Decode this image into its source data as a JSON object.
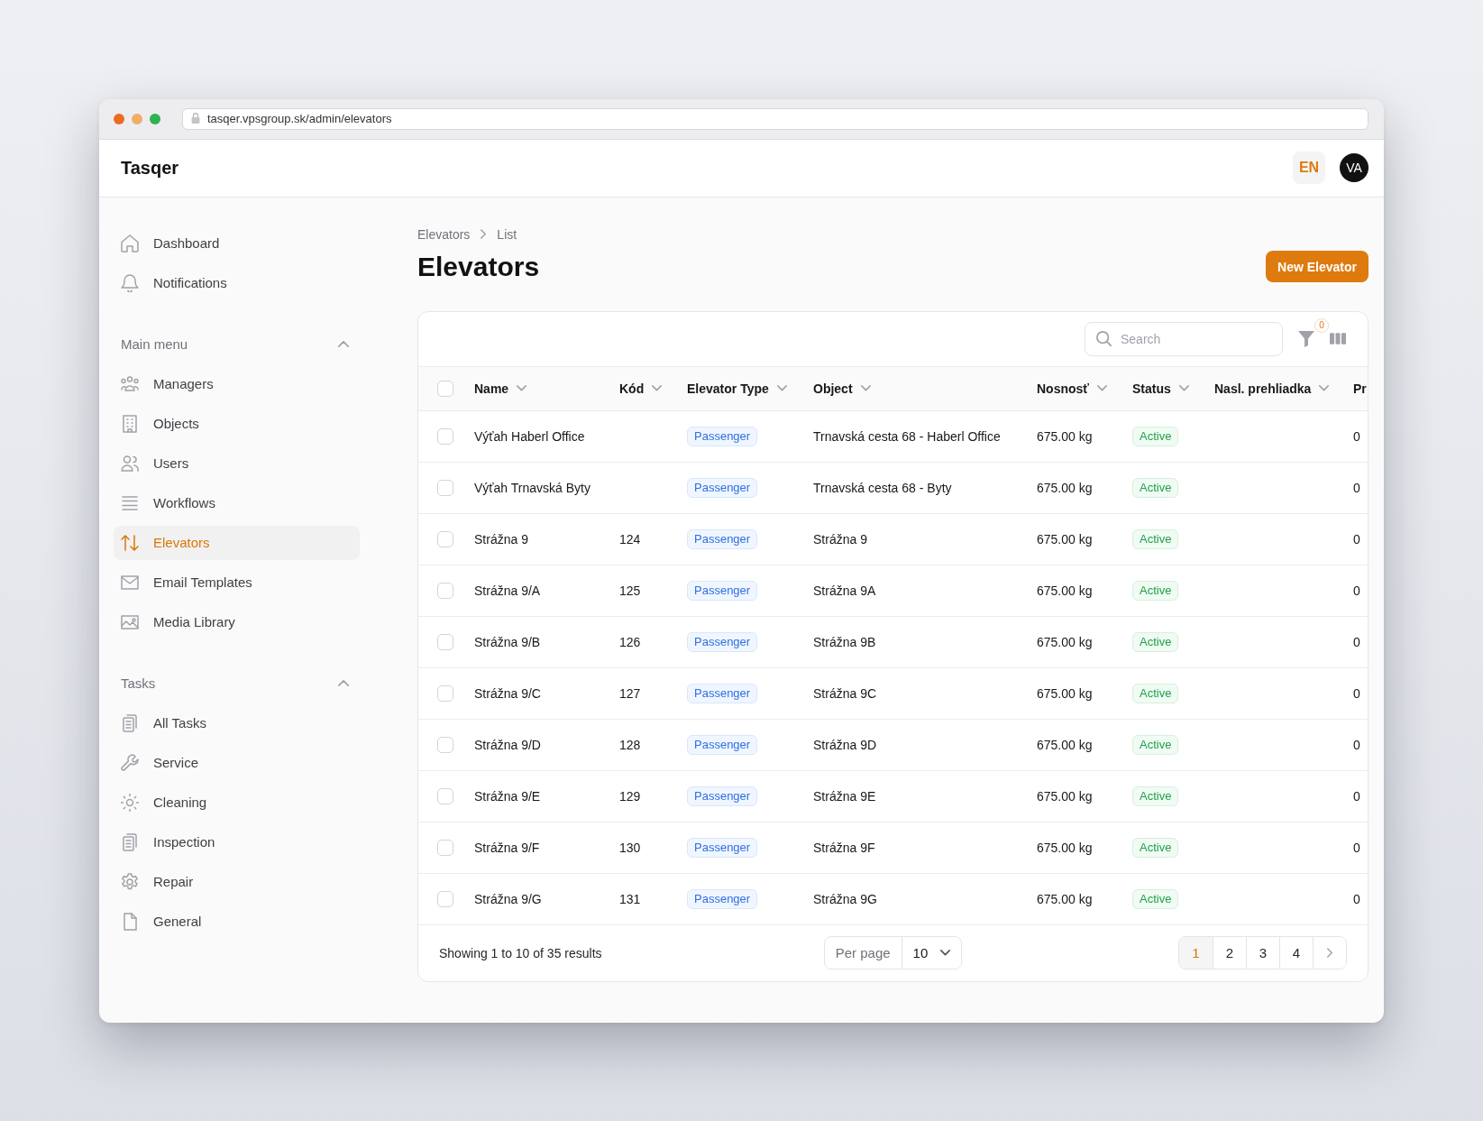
{
  "browser": {
    "url": "tasqer.vpsgroup.sk/admin/elevators"
  },
  "header": {
    "brand": "Tasqer",
    "language": "EN",
    "avatar": "VA"
  },
  "sidebar": {
    "items": [
      {
        "label": "Dashboard",
        "selected": false
      },
      {
        "label": "Notifications",
        "selected": false
      }
    ],
    "groups": [
      {
        "title": "Main menu",
        "expanded": true,
        "items": [
          {
            "label": "Managers",
            "selected": false
          },
          {
            "label": "Objects",
            "selected": false
          },
          {
            "label": "Users",
            "selected": false
          },
          {
            "label": "Workflows",
            "selected": false
          },
          {
            "label": "Elevators",
            "selected": true
          },
          {
            "label": "Email Templates",
            "selected": false
          },
          {
            "label": "Media Library",
            "selected": false
          }
        ]
      },
      {
        "title": "Tasks",
        "expanded": true,
        "items": [
          {
            "label": "All Tasks",
            "selected": false
          },
          {
            "label": "Service",
            "selected": false
          },
          {
            "label": "Cleaning",
            "selected": false
          },
          {
            "label": "Inspection",
            "selected": false
          },
          {
            "label": "Repair",
            "selected": false
          },
          {
            "label": "General",
            "selected": false
          }
        ]
      }
    ]
  },
  "breadcrumbs": [
    "Elevators",
    "List"
  ],
  "page_title": "Elevators",
  "primary_action": "New Elevator",
  "table": {
    "toolbar": {
      "search": {
        "placeholder": "Search"
      },
      "filter_count": "0"
    },
    "select_all": {
      "checked": false
    },
    "columns": [
      {
        "label": "Name",
        "sortable": true
      },
      {
        "label": "Kód",
        "sortable": true
      },
      {
        "label": "Elevator Type",
        "sortable": true
      },
      {
        "label": "Object",
        "sortable": true
      },
      {
        "label": "Nosnosť",
        "sortable": true
      },
      {
        "label": "Status",
        "sortable": true
      },
      {
        "label": "Nasl. prehliadka",
        "sortable": true
      },
      {
        "label": "Pr",
        "sortable": false
      }
    ],
    "rows": [
      {
        "checked": false,
        "name": "Výťah Haberl Office",
        "type": "Passenger",
        "object": "Trnavská cesta 68 - Haberl Office",
        "capacity": "675.00 kg",
        "status": "Active",
        "column_8": "0"
      },
      {
        "checked": false,
        "name": "Výťah Trnavská Byty",
        "type": "Passenger",
        "object": "Trnavská cesta 68 - Byty",
        "capacity": "675.00 kg",
        "status": "Active",
        "column_8": "0"
      },
      {
        "checked": false,
        "name": "Strážna 9",
        "code": "124",
        "type": "Passenger",
        "object": "Strážna 9",
        "capacity": "675.00 kg",
        "status": "Active",
        "column_8": "0"
      },
      {
        "checked": false,
        "name": "Strážna 9/A",
        "code": "125",
        "type": "Passenger",
        "object": "Strážna 9A",
        "capacity": "675.00 kg",
        "status": "Active",
        "column_8": "0"
      },
      {
        "checked": false,
        "name": "Strážna 9/B",
        "code": "126",
        "type": "Passenger",
        "object": "Strážna 9B",
        "capacity": "675.00 kg",
        "status": "Active",
        "column_8": "0"
      },
      {
        "checked": false,
        "name": "Strážna 9/C",
        "code": "127",
        "type": "Passenger",
        "object": "Strážna 9C",
        "capacity": "675.00 kg",
        "status": "Active",
        "column_8": "0"
      },
      {
        "checked": false,
        "name": "Strážna 9/D",
        "code": "128",
        "type": "Passenger",
        "object": "Strážna 9D",
        "capacity": "675.00 kg",
        "status": "Active",
        "column_8": "0"
      },
      {
        "checked": false,
        "name": "Strážna 9/E",
        "code": "129",
        "type": "Passenger",
        "object": "Strážna 9E",
        "capacity": "675.00 kg",
        "status": "Active",
        "column_8": "0"
      },
      {
        "checked": false,
        "name": "Strážna 9/F",
        "code": "130",
        "type": "Passenger",
        "object": "Strážna 9F",
        "capacity": "675.00 kg",
        "status": "Active",
        "column_8": "0"
      },
      {
        "checked": false,
        "name": "Strážna 9/G",
        "code": "131",
        "type": "Passenger",
        "object": "Strážna 9G",
        "capacity": "675.00 kg",
        "status": "Active",
        "column_8": "0"
      }
    ],
    "footer": {
      "summary": "Showing 1 to 10 of 35 results",
      "per_page": {
        "label": "Per page",
        "value": "10"
      },
      "pages": [
        {
          "label": "1",
          "selected": true
        },
        {
          "label": "2",
          "selected": false
        },
        {
          "label": "3",
          "selected": false
        },
        {
          "label": "4",
          "selected": false
        }
      ]
    }
  }
}
